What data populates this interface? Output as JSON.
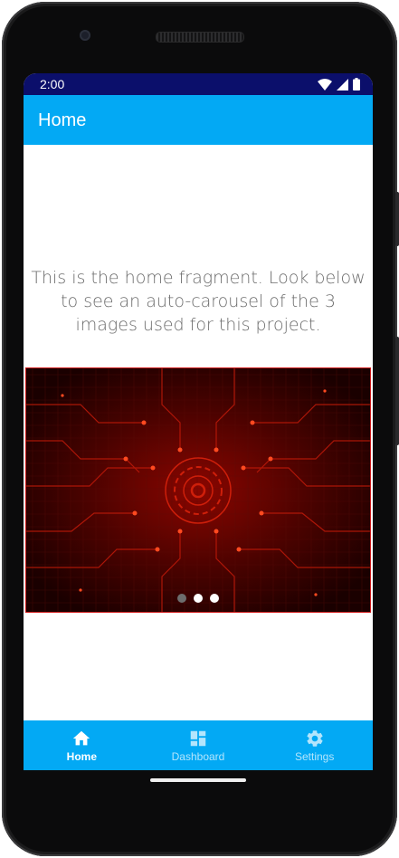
{
  "status_bar": {
    "time": "2:00"
  },
  "app_bar": {
    "title": "Home"
  },
  "content": {
    "message": "This is the home fragment. Look below to see an auto-carousel of the 3 images used for this project."
  },
  "carousel": {
    "image": "red-circuit-board-image",
    "page_count": 3,
    "active_index": 0
  },
  "bottom_nav": {
    "items": [
      {
        "label": "Home",
        "icon": "home-icon",
        "active": true
      },
      {
        "label": "Dashboard",
        "icon": "dashboard-icon",
        "active": false
      },
      {
        "label": "Settings",
        "icon": "settings-icon",
        "active": false
      }
    ]
  },
  "colors": {
    "primary": "#03a9f4",
    "status_bar": "#0b0f6b",
    "text_secondary": "#6b6b6b",
    "nav_inactive": "#b3e5fc"
  }
}
